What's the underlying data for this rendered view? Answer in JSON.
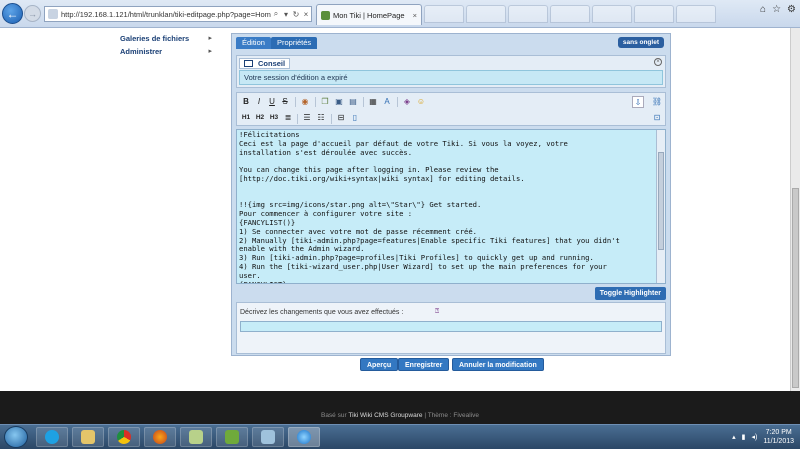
{
  "browser": {
    "url": "http://192.168.1.121/html/trunklan/tiki-editpage.php?page=HomePage",
    "tab_title": "Mon Tiki | HomePage",
    "tab_close": "×"
  },
  "sidebar": {
    "items": [
      {
        "label": "Galeries de fichiers",
        "arrow": "▸"
      },
      {
        "label": "Administrer",
        "arrow": "▸"
      }
    ]
  },
  "editor": {
    "tabs": [
      "Édition",
      "Propriétés"
    ],
    "sans_onglet": "sans onglet",
    "conseil_label": "Conseil",
    "conseil_message": "Votre session d'édition a expiré",
    "toolbar_row1": [
      "B",
      "I",
      "U",
      "S"
    ],
    "toolbar_row2": [
      "H1",
      "H2",
      "H3"
    ],
    "content": "!Félicitations\nCeci est la page d'accueil par défaut de votre Tiki. Si vous la voyez, votre\ninstallation s'est déroulée avec succès.\n\nYou can change this page after logging in. Please review the\n[http://doc.tiki.org/wiki+syntax|wiki syntax] for editing details.\n\n\n!!{img src=img/icons/star.png alt=\\\"Star\\\"} Get started.\nPour commencer à configurer votre site :\n{FANCYLIST()}\n1) Se connecter avec votre mot de passe récemment créé.\n2) Manually [tiki-admin.php?page=features|Enable specific Tiki features] that you didn't\nenable with the Admin wizard.\n3) Run [tiki-admin.php?page=profiles|Tiki Profiles] to quickly get up and running.\n4) Run the [tiki-wizard_user.php|User Wizard] to set up the main preferences for your\nuser.\n{FANCYLIST}\n\n!!{img src=img/icons/help.png alt=\\\"Help\\\"} Need help?",
    "toggle_highlighter": "Toggle Highlighter",
    "changes_label": "Décrivez les changements que vous avez effectués :"
  },
  "actions": {
    "preview": "Aperçu",
    "save": "Enregistrer",
    "cancel": "Annuler la modification"
  },
  "footer": {
    "prefix": "Basé sur",
    "link": "Tiki Wiki CMS Groupware",
    "theme": "| Thème : Fivealive"
  },
  "taskbar": {
    "time": "7:20 PM",
    "date": "11/1/2013"
  },
  "colors": {
    "accent": "#3378c2",
    "editor_bg": "#cbdcee",
    "textarea_bg": "#c6ecf8",
    "footer_bg": "#1b1b1b"
  }
}
